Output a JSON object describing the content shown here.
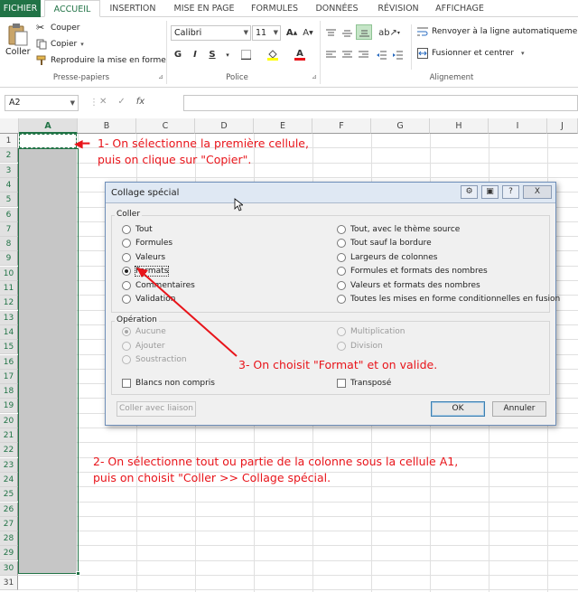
{
  "tabs": [
    "FICHIER",
    "ACCUEIL",
    "INSERTION",
    "MISE EN PAGE",
    "FORMULES",
    "DONNÉES",
    "RÉVISION",
    "AFFICHAGE"
  ],
  "ribbon": {
    "clipboard": {
      "paste": "Coller",
      "cut": "Couper",
      "copy": "Copier",
      "format_painter": "Reproduire la mise en forme",
      "label": "Presse-papiers"
    },
    "font": {
      "name": "Calibri",
      "size": "11",
      "bold": "G",
      "italic": "I",
      "underline": "S",
      "label": "Police"
    },
    "alignment": {
      "wrap": "Renvoyer à la ligne automatiquement",
      "merge": "Fusionner et centrer",
      "label": "Alignement"
    }
  },
  "formula_bar": {
    "name_box": "A2",
    "value": ""
  },
  "columns": [
    "A",
    "B",
    "C",
    "D",
    "E",
    "F",
    "G",
    "H",
    "I",
    "J"
  ],
  "rows": [
    "1",
    "2",
    "3",
    "4",
    "5",
    "6",
    "7",
    "8",
    "9",
    "10",
    "11",
    "12",
    "13",
    "14",
    "15",
    "16",
    "17",
    "18",
    "19",
    "20",
    "21",
    "22",
    "23",
    "24",
    "25",
    "26",
    "27",
    "28",
    "29",
    "30",
    "31"
  ],
  "dialog": {
    "title": "Collage spécial",
    "coller_label": "Coller",
    "paste_left": [
      {
        "label": "Tout",
        "checked": false
      },
      {
        "label": "Formules",
        "checked": false
      },
      {
        "label": "Valeurs",
        "checked": false
      },
      {
        "label": "Formats",
        "checked": true
      },
      {
        "label": "Commentaires",
        "checked": false
      },
      {
        "label": "Validation",
        "checked": false
      }
    ],
    "paste_right": [
      {
        "label": "Tout, avec le thème source"
      },
      {
        "label": "Tout sauf la bordure"
      },
      {
        "label": "Largeurs de colonnes"
      },
      {
        "label": "Formules et formats des nombres"
      },
      {
        "label": "Valeurs et formats des nombres"
      },
      {
        "label": "Toutes les mises en forme conditionnelles en fusion"
      }
    ],
    "operation_label": "Opération",
    "op_left": [
      {
        "label": "Aucune",
        "checked": true
      },
      {
        "label": "Ajouter",
        "checked": false
      },
      {
        "label": "Soustraction",
        "checked": false
      }
    ],
    "op_right": [
      {
        "label": "Multiplication"
      },
      {
        "label": "Division"
      }
    ],
    "skip_blanks": "Blancs non compris",
    "transpose": "Transposé",
    "paste_link": "Coller avec liaison",
    "ok": "OK",
    "cancel": "Annuler",
    "ctl_help": "?",
    "ctl_close": "X"
  },
  "annotations": {
    "step1_line1": "1- On sélectionne la première cellule,",
    "step1_line2": "puis on clique sur \"Copier\".",
    "step2_line1": "2- On sélectionne tout ou partie de la colonne sous la cellule A1,",
    "step2_line2": "puis on choisit \"Coller >> Collage spécial.",
    "step3": "3- On choisit \"Format\" et on valide."
  },
  "colors": {
    "excel_green": "#217346",
    "annotation_red": "#e8141a"
  }
}
